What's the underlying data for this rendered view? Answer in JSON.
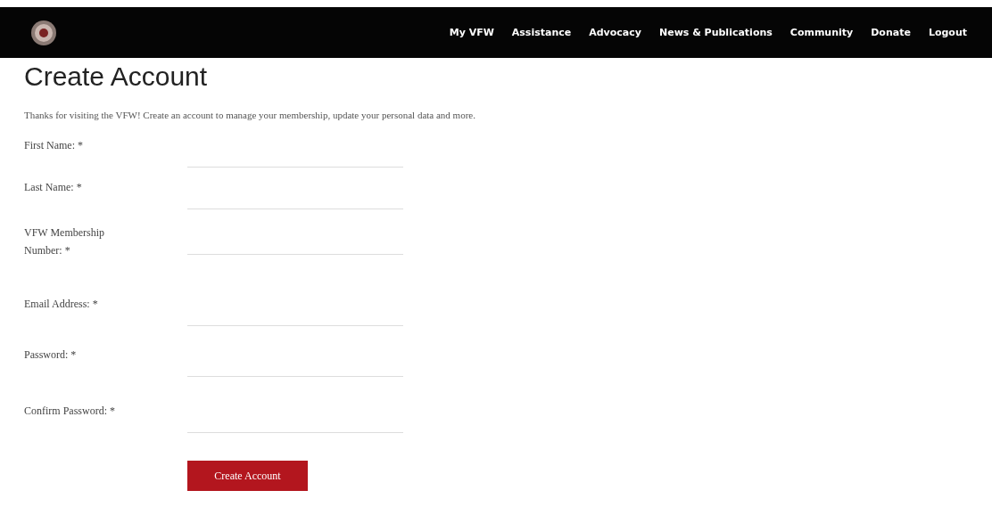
{
  "nav": {
    "links": [
      {
        "label": "My VFW"
      },
      {
        "label": "Assistance"
      },
      {
        "label": "Advocacy"
      },
      {
        "label": "News & Publications"
      },
      {
        "label": "Community"
      },
      {
        "label": "Donate"
      },
      {
        "label": "Logout"
      }
    ]
  },
  "page": {
    "title": "Create Account",
    "intro": "Thanks for visiting the VFW! Create an account to manage your membership, update your personal data and more."
  },
  "form": {
    "fields": [
      {
        "label": "First Name: *"
      },
      {
        "label": "Last Name: *"
      },
      {
        "label": "VFW Membership Number: *"
      },
      {
        "label": "Email Address: *"
      },
      {
        "label": "Password: *"
      },
      {
        "label": "Confirm Password: *"
      }
    ],
    "submit": "Create Account"
  }
}
